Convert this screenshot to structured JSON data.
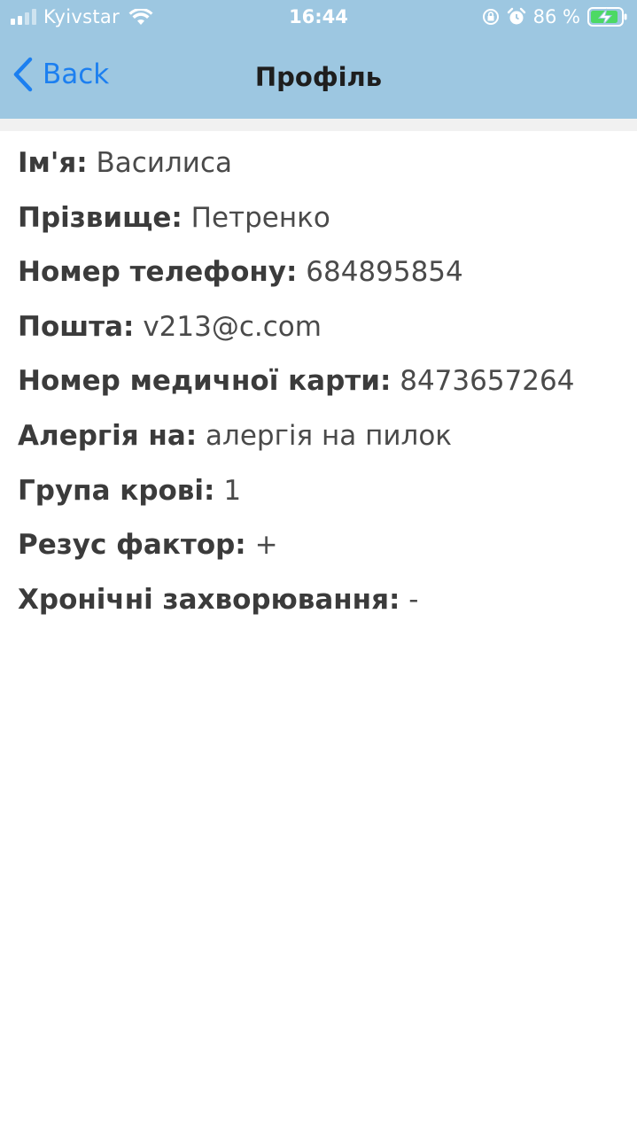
{
  "statusbar": {
    "carrier": "Kyivstar",
    "time": "16:44",
    "battery": "86 %",
    "icons": [
      "signal-icon",
      "wifi-icon",
      "lock-rotation-icon",
      "alarm-icon",
      "battery-charging-icon"
    ]
  },
  "nav": {
    "back_label": "Back",
    "title": "Профіль"
  },
  "profile": [
    {
      "label": "Ім'я:",
      "value": "Василиса"
    },
    {
      "label": "Прізвище:",
      "value": "Петренко"
    },
    {
      "label": "Номер телефону:",
      "value": "684895854"
    },
    {
      "label": "Пошта:",
      "value": "v213@c.com"
    },
    {
      "label": "Номер медичної карти:",
      "value": "8473657264"
    },
    {
      "label": "Алергія на:",
      "value": "алергія на пилок"
    },
    {
      "label": "Група крові:",
      "value": "1"
    },
    {
      "label": "Резус фактор:",
      "value": "+"
    },
    {
      "label": "Хронічні захворювання:",
      "value": "-"
    }
  ],
  "colors": {
    "header_bg": "#9dc7e1",
    "accent": "#1c7ff0",
    "battery_green": "#4cd964"
  }
}
